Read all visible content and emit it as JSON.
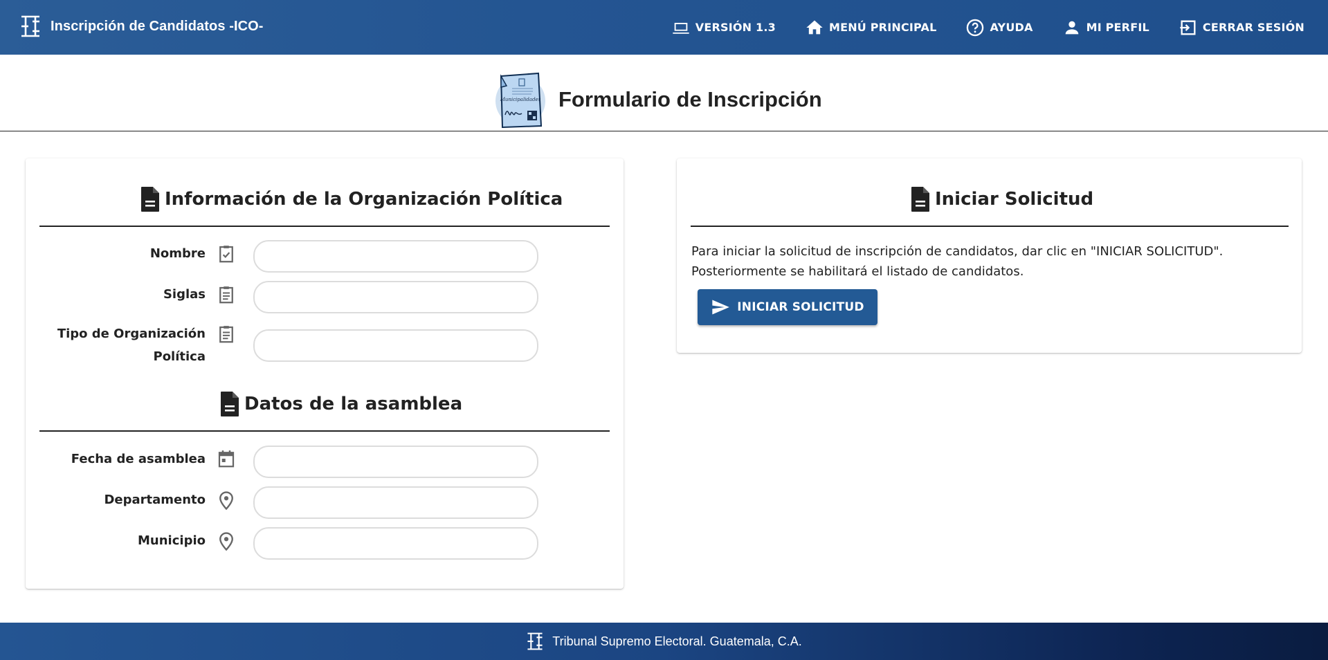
{
  "app": {
    "title": "Inscripción de Candidatos -ICO-"
  },
  "nav": {
    "version_label": "VERSIÓN 1.3",
    "menu_label": "MENÚ PRINCIPAL",
    "help_label": "AYUDA",
    "profile_label": "MI PERFIL",
    "logout_label": "CERRAR SESIÓN"
  },
  "page": {
    "title": "Formulario de Inscripción",
    "illustration_caption": "Municipalidades"
  },
  "org_section": {
    "title": "Información de la Organización Política",
    "fields": [
      {
        "label": "Nombre",
        "icon": "clipboard-check-icon",
        "value": ""
      },
      {
        "label": "Siglas",
        "icon": "clipboard-text-icon",
        "value": ""
      },
      {
        "label_line1": "Tipo de Organización",
        "label_line2": "Política",
        "icon": "clipboard-text-icon",
        "value": ""
      }
    ]
  },
  "assembly_section": {
    "title": "Datos de la asamblea",
    "fields": [
      {
        "label": "Fecha de asamblea",
        "icon": "calendar-icon",
        "value": ""
      },
      {
        "label": "Departamento",
        "icon": "map-pin-icon",
        "value": ""
      },
      {
        "label": "Municipio",
        "icon": "map-pin-icon",
        "value": ""
      }
    ]
  },
  "request_section": {
    "title": "Iniciar Solicitud",
    "line1": "Para iniciar la solicitud de inscripción de candidatos, dar clic en \"INICIAR SOLICITUD\".",
    "line2": "Posteriormente se habilitará el listado de candidatos.",
    "button_label": "INICIAR SOLICITUD"
  },
  "footer": {
    "text": "Tribunal Supremo Electoral. Guatemala, C.A."
  },
  "colors": {
    "header": "#245592",
    "button": "#235a95",
    "footer_dark": "#0a1c40"
  }
}
